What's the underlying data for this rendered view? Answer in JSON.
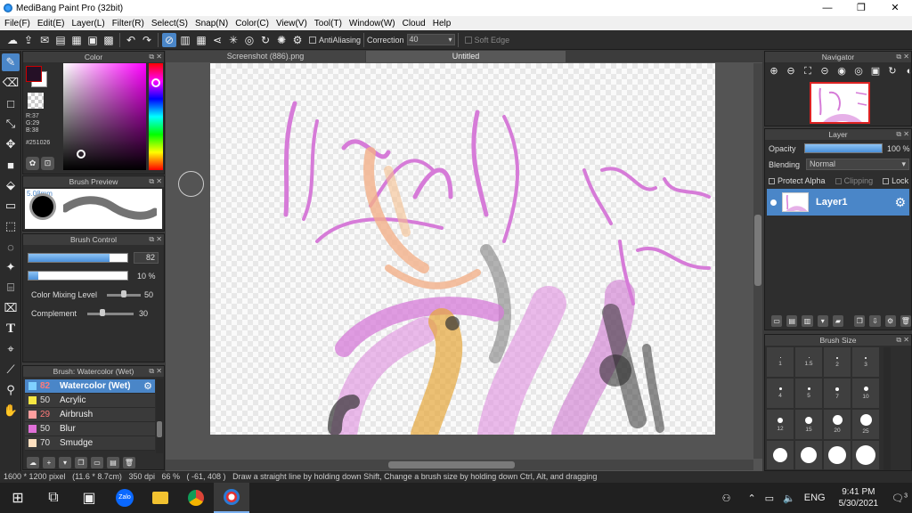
{
  "window": {
    "title": "MediBang Paint Pro (32bit)",
    "controls": [
      "—",
      "❐",
      "✕"
    ]
  },
  "menu": [
    "File(F)",
    "Edit(E)",
    "Layer(L)",
    "Filter(R)",
    "Select(S)",
    "Snap(N)",
    "Color(C)",
    "View(V)",
    "Tool(T)",
    "Window(W)",
    "Cloud",
    "Help"
  ],
  "toolbar": {
    "antialiasing_label": "AntiAliasing",
    "correction_label": "Correction",
    "correction_value": "40",
    "soft_edge_label": "Soft Edge"
  },
  "color_panel": {
    "title": "Color",
    "r": "R:37",
    "g": "G:29",
    "b": "B:38",
    "hex": "#251026",
    "foreground": "#251026"
  },
  "brush_preview": {
    "title": "Brush Preview",
    "size": "5.08mm"
  },
  "brush_control": {
    "title": "Brush Control",
    "size_value": "82",
    "size_level": 0.82,
    "opacity_value": "10 %",
    "opacity_level": 0.1,
    "color_mixing_label": "Color Mixing Level",
    "color_mixing_value": "50",
    "complement_label": "Complement",
    "complement_value": "30"
  },
  "brush_list": {
    "title": "Brush: Watercolor (Wet)",
    "items": [
      {
        "size": "82",
        "name": "Watercolor (Wet)",
        "color": "#7fd0ff",
        "selected": true
      },
      {
        "size": "50",
        "name": "Acrylic",
        "color": "#f5e642"
      },
      {
        "size": "29",
        "name": "Airbrush",
        "color": "#ff9e9e"
      },
      {
        "size": "50",
        "name": "Blur",
        "color": "#e070d8"
      },
      {
        "size": "70",
        "name": "Smudge",
        "color": "#ffe0c0"
      }
    ]
  },
  "tabs": [
    {
      "label": "Screenshot (886).png",
      "active": false
    },
    {
      "label": "Untitled",
      "active": true
    }
  ],
  "navigator": {
    "title": "Navigator"
  },
  "layer_panel": {
    "title": "Layer",
    "opacity_label": "Opacity",
    "opacity_value": "100 %",
    "blending_label": "Blending",
    "blending_value": "Normal",
    "protect_alpha": "Protect Alpha",
    "clipping": "Clipping",
    "lock": "Lock",
    "layer_name": "Layer1"
  },
  "brush_size_panel": {
    "title": "Brush Size",
    "labels": [
      "1",
      "1.5",
      "2",
      "3",
      "4",
      "5",
      "7",
      "10",
      "12",
      "15",
      "20",
      "25"
    ]
  },
  "status": {
    "dimensions": "1600 * 1200 pixel",
    "physical": "(11.6 * 8.7cm)",
    "dpi": "350 dpi",
    "zoom": "66 %",
    "coords": "( -61, 408 )",
    "hint": "Draw a straight line by holding down Shift, Change a brush size by holding down Ctrl, Alt, and dragging"
  },
  "taskbar": {
    "lang": "ENG",
    "time": "9:41 PM",
    "date": "5/30/2021",
    "notifications": "3"
  }
}
